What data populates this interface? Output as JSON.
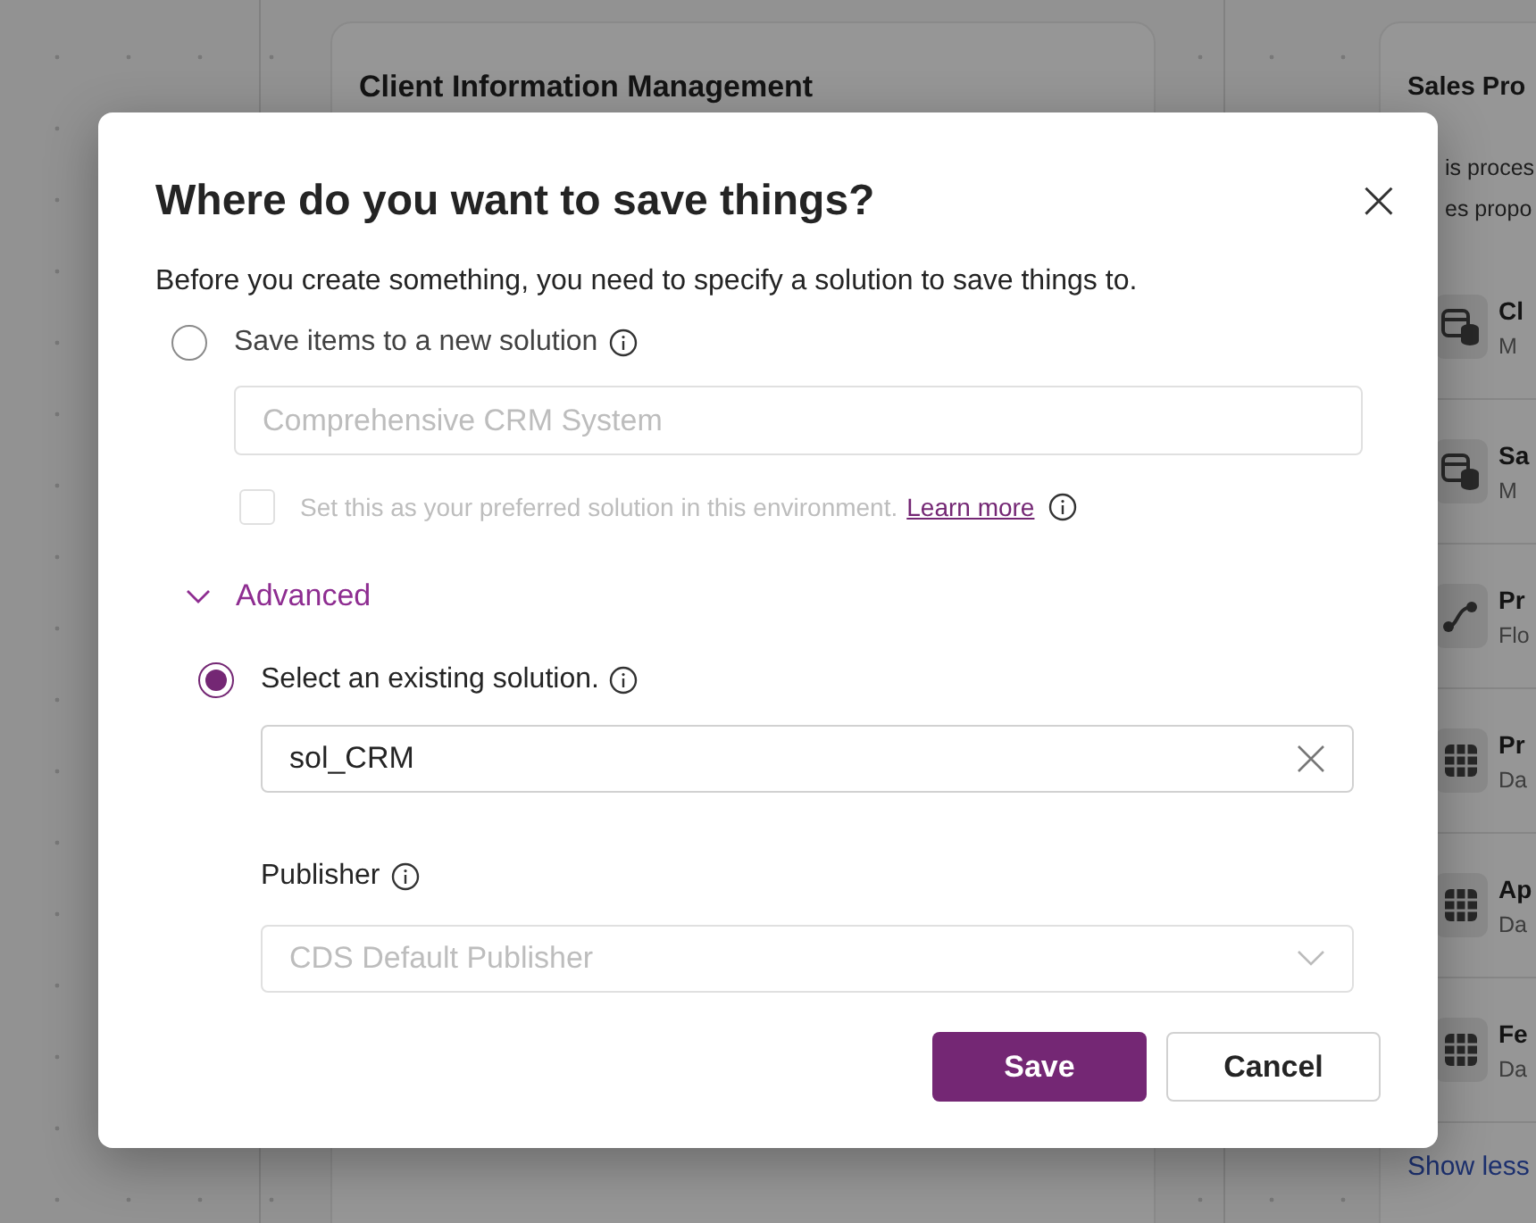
{
  "background": {
    "left_card": {
      "title": "Client Information Management"
    },
    "right_card": {
      "title": "Sales Pro",
      "description": [
        "is proces",
        "es propo"
      ],
      "items": [
        {
          "kind": "app",
          "title": "Cl",
          "subtitle": "M"
        },
        {
          "kind": "app",
          "title": "Sa",
          "subtitle": "M"
        },
        {
          "kind": "flow",
          "title": "Pr",
          "subtitle": "Flo"
        },
        {
          "kind": "table",
          "title": "Pr",
          "subtitle": "Da"
        },
        {
          "kind": "table",
          "title": "Ap",
          "subtitle": "Da"
        },
        {
          "kind": "table",
          "title": "Fe",
          "subtitle": "Da"
        }
      ],
      "link": "Show less"
    }
  },
  "dialog": {
    "title": "Where do you want to save things?",
    "close": "×",
    "description": "Before you create something, you need to specify a solution to save things to.",
    "new_solution": {
      "label": "Save items to a new solution",
      "selected": false,
      "name_field": {
        "placeholder": "Comprehensive CRM System",
        "disabled": true
      },
      "preferred": {
        "label": "Set this as your preferred solution in this environment.",
        "link": "Learn more",
        "checked": false,
        "disabled": true
      }
    },
    "advanced": {
      "label": "Advanced",
      "expanded": true
    },
    "existing_solution": {
      "label": "Select an existing solution.",
      "selected": true,
      "field": {
        "value": "sol_CRM"
      }
    },
    "publisher": {
      "label": "Publisher",
      "dropdown": {
        "value": "CDS Default Publisher",
        "disabled": true
      }
    },
    "buttons": [
      {
        "label": "Save",
        "kind": "primary"
      },
      {
        "label": "Cancel",
        "kind": "secondary"
      }
    ]
  }
}
